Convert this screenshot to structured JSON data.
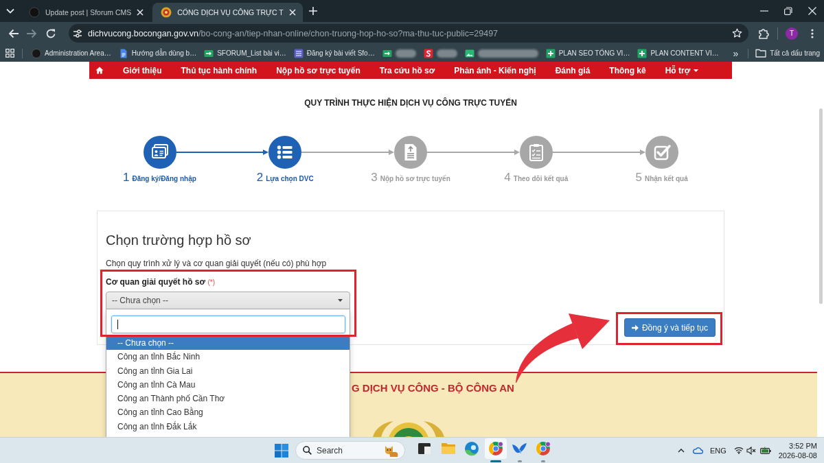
{
  "browser": {
    "tabs": [
      {
        "title": "Update post | Sforum CMS",
        "selected": false
      },
      {
        "title": "CỔNG DỊCH VỤ CÔNG TRỰC T",
        "selected": true
      }
    ],
    "address": {
      "host": "dichvucong.bocongan.gov.vn",
      "path": "/bo-cong-an/tiep-nhan-online/chon-truong-hop-ho-so?ma-thu-tuc-public=29497"
    },
    "profile_initial": "T",
    "bookmarks": [
      {
        "label": "Administration Area…",
        "redacted": false
      },
      {
        "label": "Hướng dẫn dùng b…",
        "redacted": false
      },
      {
        "label": "SFORUM_List bài vi…",
        "redacted": false
      },
      {
        "label": "Đăng ký bài viết Sfo…",
        "redacted": false
      },
      {
        "redacted": true
      },
      {
        "redacted": true
      },
      {
        "redacted": true
      },
      {
        "label": "PLAN SEO TỔNG VI…",
        "redacted": false
      },
      {
        "label": "PLAN CONTENT VI…",
        "redacted": false
      }
    ],
    "bookmarks_overflow": "»",
    "all_bookmarks": "Tất cả dấu trang"
  },
  "nav": {
    "items": [
      {
        "label": "Giới thiệu",
        "has_menu": false
      },
      {
        "label": "Thủ tục hành chính",
        "has_menu": false
      },
      {
        "label": "Nộp hồ sơ trực tuyến",
        "has_menu": false
      },
      {
        "label": "Tra cứu hồ sơ",
        "has_menu": false
      },
      {
        "label": "Phản ánh - Kiến nghị",
        "has_menu": false
      },
      {
        "label": "Đánh giá",
        "has_menu": false
      },
      {
        "label": "Thông kê",
        "has_menu": false
      },
      {
        "label": "Hỗ trợ",
        "has_menu": true
      }
    ]
  },
  "process": {
    "title": "QUY TRÌNH THỰC HIỆN DỊCH VỤ CÔNG TRỰC TUYẾN",
    "steps": [
      {
        "number": "1",
        "label": "Đăng ký/Đăng nhập",
        "active": true
      },
      {
        "number": "2",
        "label": "Lựa chọn DVC",
        "active": true
      },
      {
        "number": "3",
        "label": "Nộp hồ sơ trực tuyến",
        "active": false
      },
      {
        "number": "4",
        "label": "Theo dõi kết quả",
        "active": false
      },
      {
        "number": "5",
        "label": "Nhận kết quả",
        "active": false
      }
    ]
  },
  "form": {
    "heading": "Chọn trường hợp hồ sơ",
    "description": "Chọn quy trình xử lý và cơ quan giải quyết (nếu có) phù hợp",
    "field_label": "Cơ quan giải quyết hồ sơ",
    "required_mark": "(*)",
    "select": {
      "value": "-- Chưa chọn --",
      "expanded": true
    },
    "search": {
      "focused": true
    },
    "options": [
      {
        "label": "-- Chưa chọn --",
        "selected": true
      },
      {
        "label": "Công an tỉnh Bắc Ninh",
        "selected": false
      },
      {
        "label": "Công an tỉnh Gia Lai",
        "selected": false
      },
      {
        "label": "Công an tỉnh Cà Mau",
        "selected": false
      },
      {
        "label": "Công an Thành phố Cần Thơ",
        "selected": false
      },
      {
        "label": "Công an tỉnh Cao Bằng",
        "selected": false
      },
      {
        "label": "Công an tỉnh Đắk Lắk",
        "selected": false
      }
    ],
    "submit_button": "Đồng ý và tiếp tục"
  },
  "footer": {
    "title": "G DỊCH VỤ CÔNG - BỘ CÔNG AN"
  },
  "annotations": {
    "field_frame": true,
    "button_frame": true,
    "arrow": true
  },
  "taskbar": {
    "search_label": "Search",
    "apps": [
      {
        "running": false,
        "selected": false
      },
      {
        "running": false,
        "selected": false
      },
      {
        "running": false,
        "selected": false
      },
      {
        "running": true,
        "selected": true
      },
      {
        "running": true,
        "selected": false
      },
      {
        "running": true,
        "selected": false
      }
    ],
    "language": "ENG",
    "time": "3:52 PM",
    "date": "2026-08-08"
  }
}
